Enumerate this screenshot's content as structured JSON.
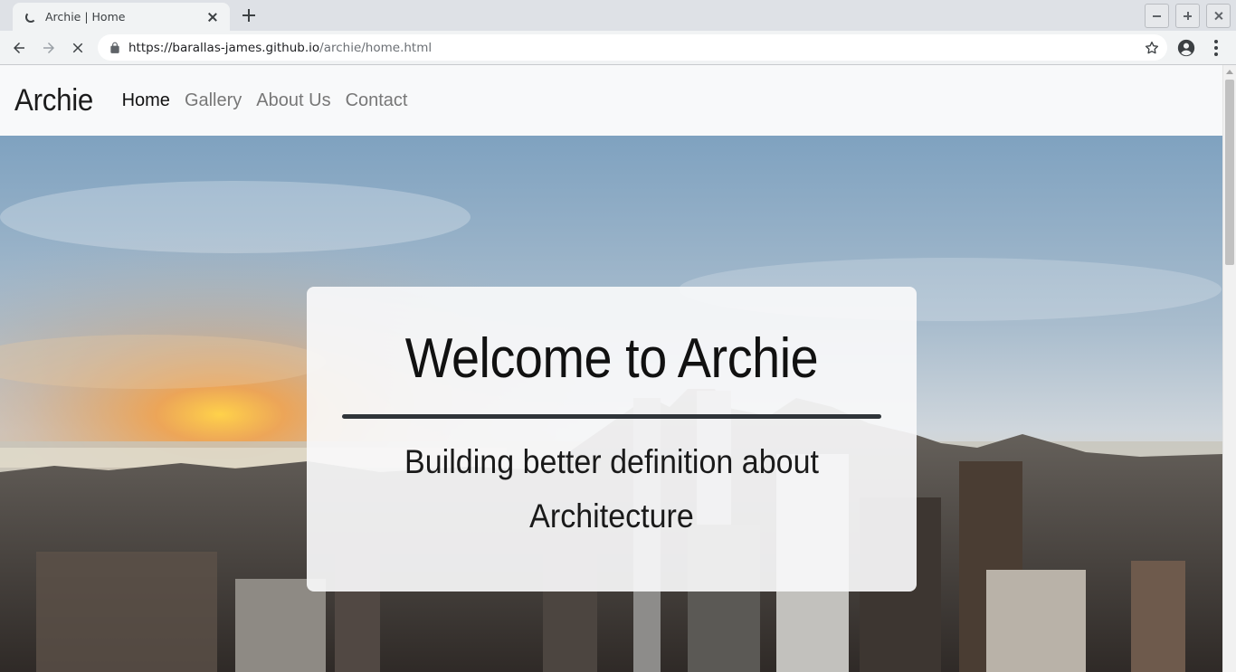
{
  "browser": {
    "tab_title": "Archie | Home",
    "url_host": "https://barallas-james.github.io",
    "url_path": "/archie/home.html"
  },
  "site": {
    "brand": "Archie",
    "nav": [
      {
        "label": "Home",
        "active": true
      },
      {
        "label": "Gallery",
        "active": false
      },
      {
        "label": "About Us",
        "active": false
      },
      {
        "label": "Contact",
        "active": false
      }
    ]
  },
  "hero": {
    "title": "Welcome to Archie",
    "subtitle": "Building better definition about Architecture"
  },
  "icons": {
    "tab": "loading-spinner-icon",
    "back": "arrow-left-icon",
    "forward": "arrow-right-icon",
    "stop": "close-icon",
    "lock": "lock-icon",
    "bookmark": "star-icon",
    "account": "account-circle-icon",
    "menu": "more-vert-icon"
  },
  "colors": {
    "nav_bg": "#f8f9fa",
    "card_bg": "#f8f9fa",
    "divider": "#2f3439"
  }
}
